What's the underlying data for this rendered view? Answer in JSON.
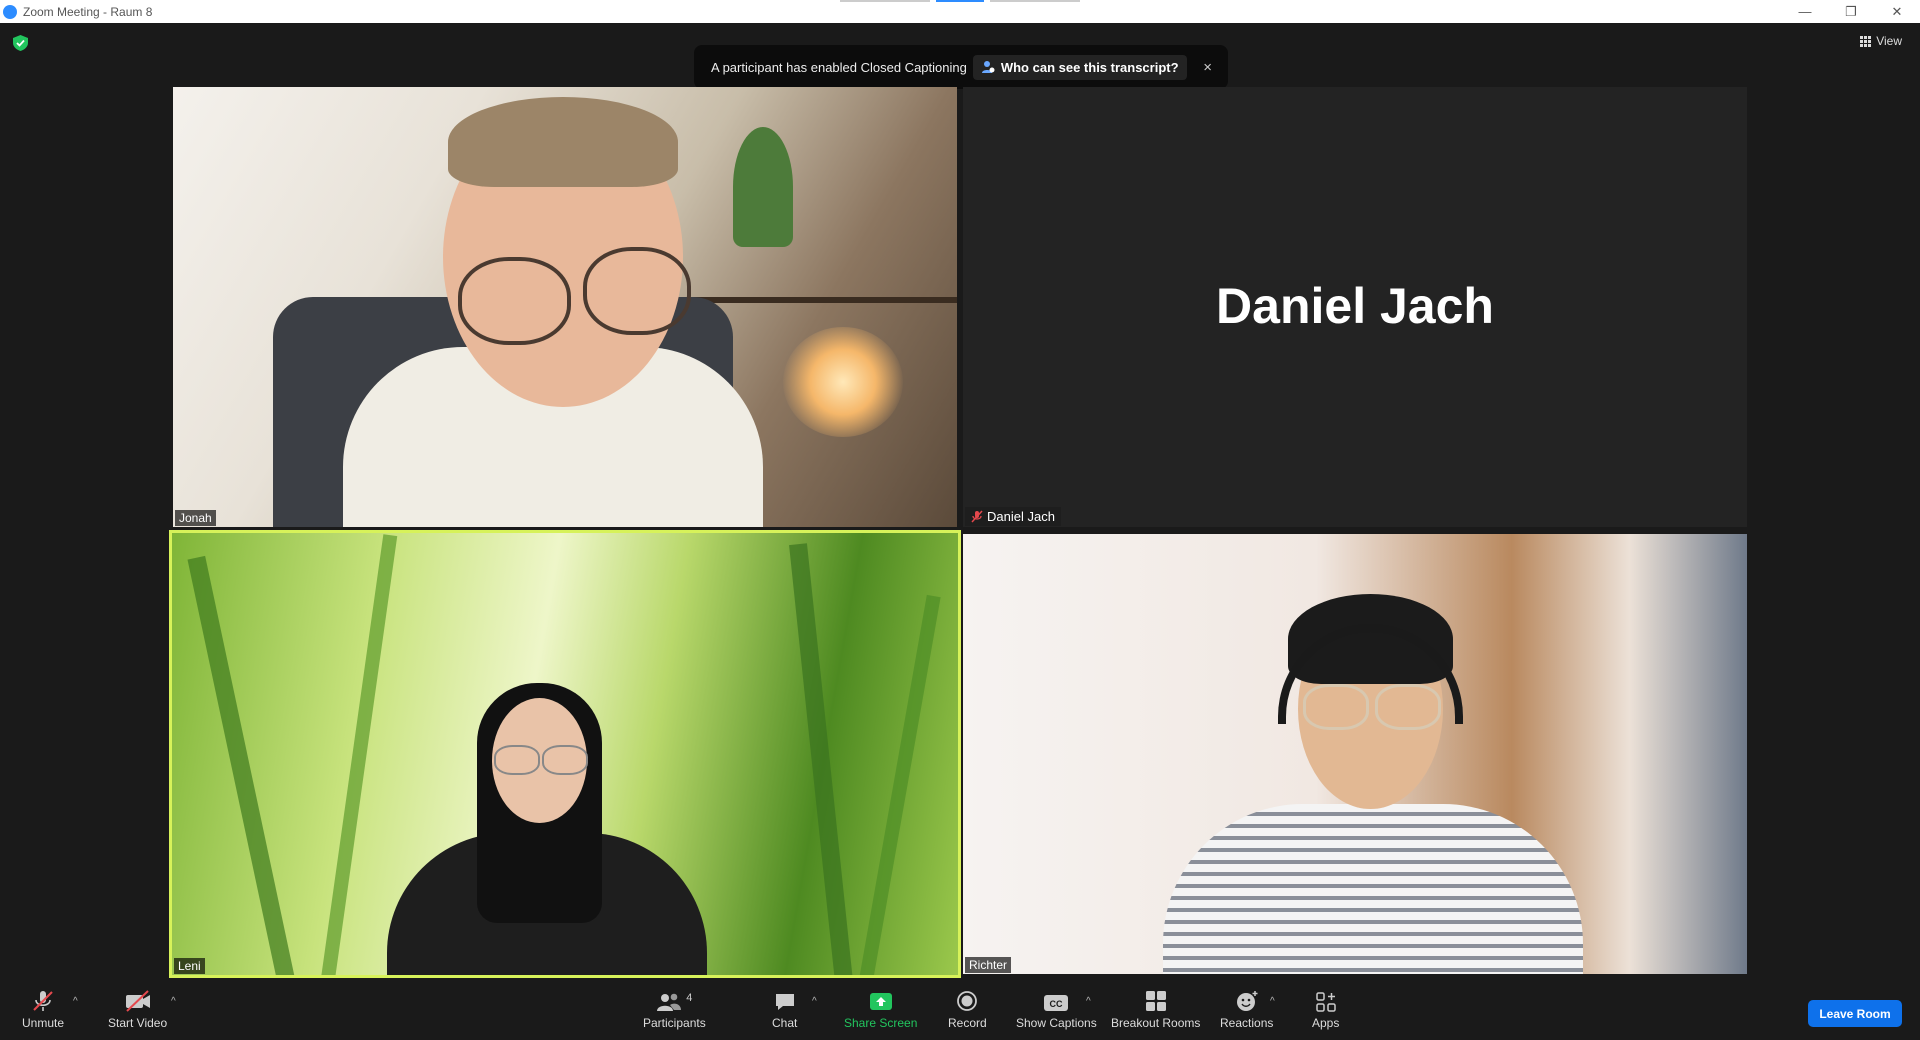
{
  "window": {
    "title": "Zoom Meeting - Raum 8",
    "controls": [
      "minimize",
      "restore",
      "close"
    ]
  },
  "top_bar": {
    "view_label": "View"
  },
  "caption_banner": {
    "message": "A participant has enabled Closed Captioning",
    "who_label": "Who can see this transcript?",
    "close_label": "×"
  },
  "participants": [
    {
      "name": "Jonah",
      "video": true
    },
    {
      "name": "Daniel Jach",
      "video": false,
      "muted": true
    },
    {
      "name": "Leni",
      "video": true,
      "active_speaker": true
    },
    {
      "name": "Richter",
      "video": true
    }
  ],
  "toolbar": {
    "unmute": "Unmute",
    "start_video": "Start Video",
    "participants": "Participants",
    "participants_count": "4",
    "chat": "Chat",
    "share_screen": "Share Screen",
    "record": "Record",
    "show_captions": "Show Captions",
    "breakout_rooms": "Breakout Rooms",
    "reactions": "Reactions",
    "apps": "Apps",
    "leave": "Leave Room"
  },
  "colors": {
    "background": "#1a1a1a",
    "active_speaker_border": "#d7f25a",
    "share_green": "#22c55e",
    "leave_blue": "#0e71eb"
  }
}
